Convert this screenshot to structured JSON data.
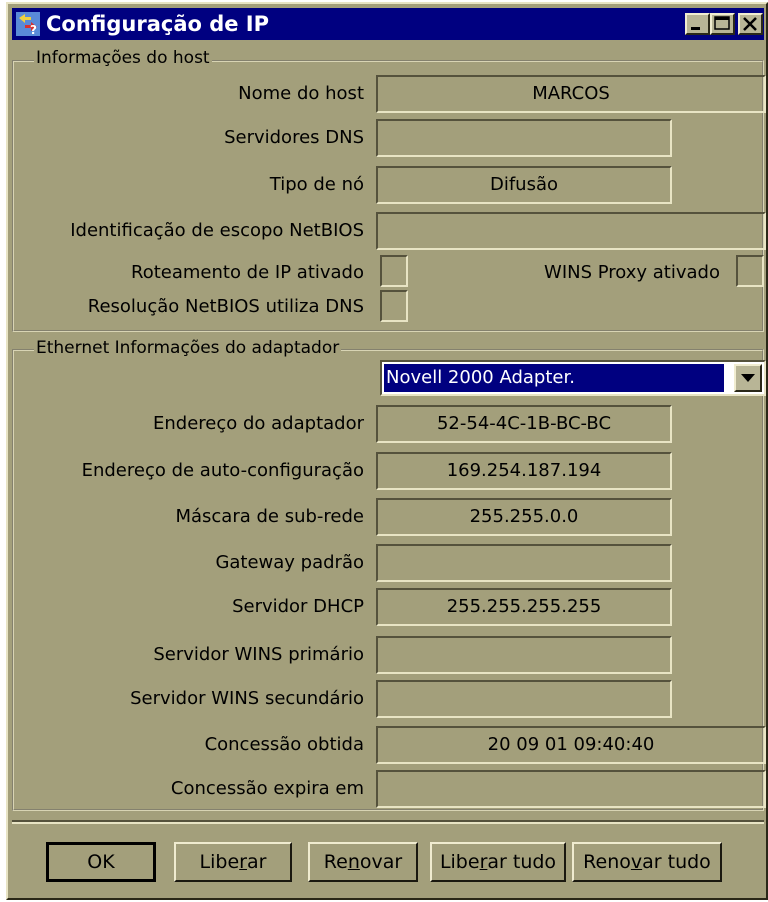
{
  "window": {
    "title": "Configuração de IP"
  },
  "host_info": {
    "legend": "Informações do host",
    "host_name": {
      "label": "Nome do host",
      "value": "MARCOS"
    },
    "dns_servers": {
      "label": "Servidores DNS",
      "value": ""
    },
    "node_type": {
      "label": "Tipo de nó",
      "value": "Difusão"
    },
    "netbios_scope": {
      "label": "Identificação de escopo NetBIOS",
      "value": ""
    },
    "ip_routing": {
      "label": "Roteamento de IP ativado",
      "checked": false
    },
    "wins_proxy": {
      "label": "WINS Proxy ativado",
      "checked": false
    },
    "netbios_dns": {
      "label": "Resolução NetBIOS utiliza DNS",
      "checked": false
    }
  },
  "adapter_info": {
    "legend": "Ethernet  Informações do adaptador",
    "selected_adapter": "Novell 2000 Adapter.",
    "fields": [
      {
        "label": "Endereço do adaptador",
        "value": "52-54-4C-1B-BC-BC"
      },
      {
        "label": "Endereço de auto-configuração",
        "value": "169.254.187.194"
      },
      {
        "label": "Máscara de sub-rede",
        "value": "255.255.0.0"
      },
      {
        "label": "Gateway padrão",
        "value": ""
      },
      {
        "label": "Servidor DHCP",
        "value": "255.255.255.255"
      },
      {
        "label": "Servidor WINS primário",
        "value": ""
      },
      {
        "label": "Servidor WINS secundário",
        "value": ""
      },
      {
        "label": "Concessão obtida",
        "value": "20 09 01 09:40:40"
      },
      {
        "label": "Concessão expira em",
        "value": ""
      }
    ]
  },
  "buttons": {
    "ok": "OK",
    "release": {
      "pre": "Libe",
      "mnemonic": "r",
      "post": "ar"
    },
    "renew": {
      "pre": "Re",
      "mnemonic": "n",
      "post": "ovar"
    },
    "release_all": {
      "pre": "Libe",
      "mnemonic": "r",
      "post": "ar tudo"
    },
    "renew_all": {
      "pre": "Reno",
      "mnemonic": "v",
      "post": "ar tudo"
    }
  },
  "colors": {
    "face": "#a39f7b",
    "title_bar": "#000080"
  },
  "icons": [
    "ipconfig-app-icon",
    "minimize-icon",
    "maximize-icon",
    "close-icon",
    "dropdown-arrow-icon"
  ]
}
